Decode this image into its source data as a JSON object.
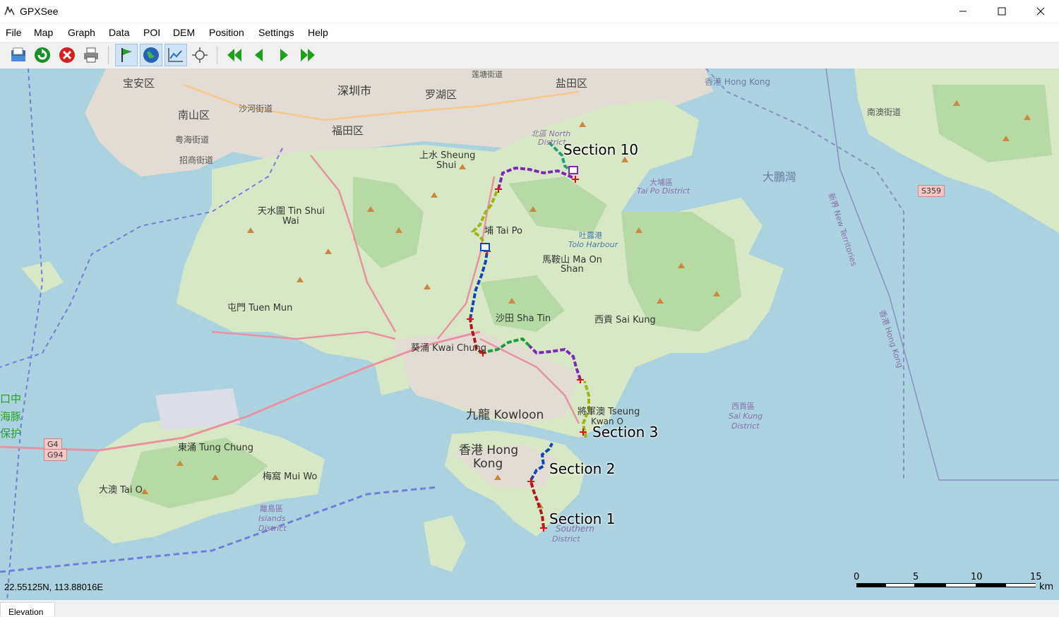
{
  "window": {
    "title": "GPXSee"
  },
  "menu": [
    "File",
    "Map",
    "Graph",
    "Data",
    "POI",
    "DEM",
    "Position",
    "Settings",
    "Help"
  ],
  "toolbar": {
    "buttons": [
      {
        "name": "open-icon"
      },
      {
        "name": "reload-icon"
      },
      {
        "name": "close-file-icon"
      },
      {
        "name": "print-icon"
      },
      {
        "name": "show-poi-icon"
      },
      {
        "name": "show-map-icon"
      },
      {
        "name": "show-graphs-icon"
      },
      {
        "name": "show-position-icon"
      },
      {
        "name": "first-icon"
      },
      {
        "name": "previous-icon"
      },
      {
        "name": "next-icon"
      },
      {
        "name": "last-icon"
      }
    ]
  },
  "map": {
    "coordinates": "22.55125N, 113.88016E",
    "labels": {
      "l_baoan": "宝安区",
      "l_nanshan": "南山区",
      "l_shekou": "沙河街道",
      "l_yuehai": "粤海街道",
      "l_zhaoshang": "招商街道",
      "l_shenzhen": "深圳市",
      "l_luohu": "罗湖区",
      "l_futian": "福田区",
      "l_yantian": "盐田区",
      "l_lianhe": "莲塘街道",
      "l_shangshui": "上水 Sheung",
      "l_shui": "Shui",
      "l_tinshui": "天水圍 Tin Shui",
      "l_wai": "Wai",
      "l_tuenmun": "屯門 Tuen Mun",
      "l_taipo": "埔 Tai Po",
      "l_taipodist": "大埔區",
      "l_taipodist2": "Tai Po District",
      "l_tolo": "吐露港",
      "l_tolo2": "Tolo Harbour",
      "l_maonshan": "馬鞍山 Ma On",
      "l_shan": "Shan",
      "l_shatin": "沙田 Sha Tin",
      "l_saikung": "西貢 Sai Kung",
      "l_kwaichung": "葵涌 Kwai Chung",
      "l_kowloon": "九龍 Kowloon",
      "l_tko": "將軍澳 Tseung",
      "l_kwano": "Kwan O",
      "l_hk": "香港 Hong",
      "l_kong": "Kong",
      "l_tungchung": "東涌 Tung Chung",
      "l_muiwo": "梅窩 Mui Wo",
      "l_taio": "大澳 Tai O",
      "l_islands": "離島區",
      "l_islands2": "Islands",
      "l_islands3": "District",
      "l_southern": "Southern",
      "l_district": "District",
      "l_saikungd": "西貢區",
      "l_saikungd2": "Sai Kung",
      "l_saikungd3": "District",
      "l_hkwater": "香港 Hong Kong",
      "l_mirsbay": "大鵬灣",
      "l_nanao": "南澳街道",
      "l_northdist": "北區 North",
      "l_dist": "District",
      "l_newterr": "新界 New Territories",
      "l_hkvert": "香港 Hong Kong",
      "l_s359": "S359",
      "l_g4": "G4",
      "l_g94": "G94",
      "l_zhong": "口中",
      "l_haitun": "海豚",
      "l_baohu": "保护",
      "l_west": "西貢 Sai Kung District",
      "l_shenzhenwan": "深圳市"
    },
    "sections": [
      "Section 10",
      "Section 3",
      "Section 2",
      "Section 1"
    ],
    "scale": {
      "ticks": [
        "0",
        "5",
        "10",
        "15"
      ],
      "unit": "km"
    }
  },
  "status": {
    "tab": "Elevation"
  }
}
